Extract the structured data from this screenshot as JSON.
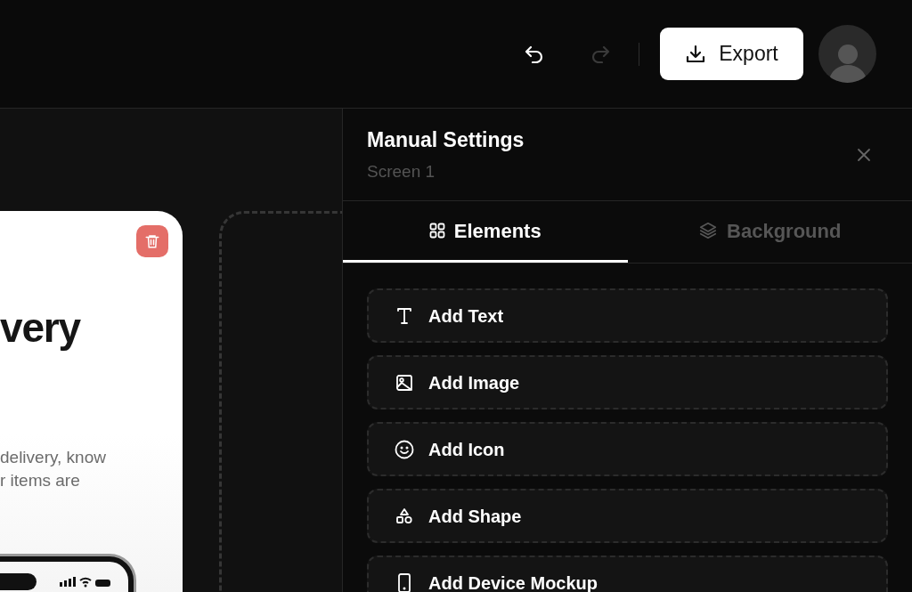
{
  "toolbar": {
    "undo": {
      "disabled": false
    },
    "redo": {
      "disabled": true
    },
    "export_button": {
      "label": "Export"
    }
  },
  "canvas": {
    "screen": {
      "title": "very",
      "description_lines": [
        "delivery, know",
        "r items are"
      ]
    }
  },
  "panel": {
    "title": "Manual Settings",
    "subtitle": "Screen 1",
    "tabs": [
      {
        "label": "Elements",
        "kind": "elements",
        "selected": true
      },
      {
        "label": "Background",
        "kind": "background",
        "selected": false
      }
    ],
    "items": [
      {
        "label": "Add Text",
        "kind": "text"
      },
      {
        "label": "Add Image",
        "kind": "image"
      },
      {
        "label": "Add Icon",
        "kind": "icon"
      },
      {
        "label": "Add Shape",
        "kind": "shape"
      },
      {
        "label": "Add Device Mockup",
        "kind": "device"
      }
    ]
  }
}
